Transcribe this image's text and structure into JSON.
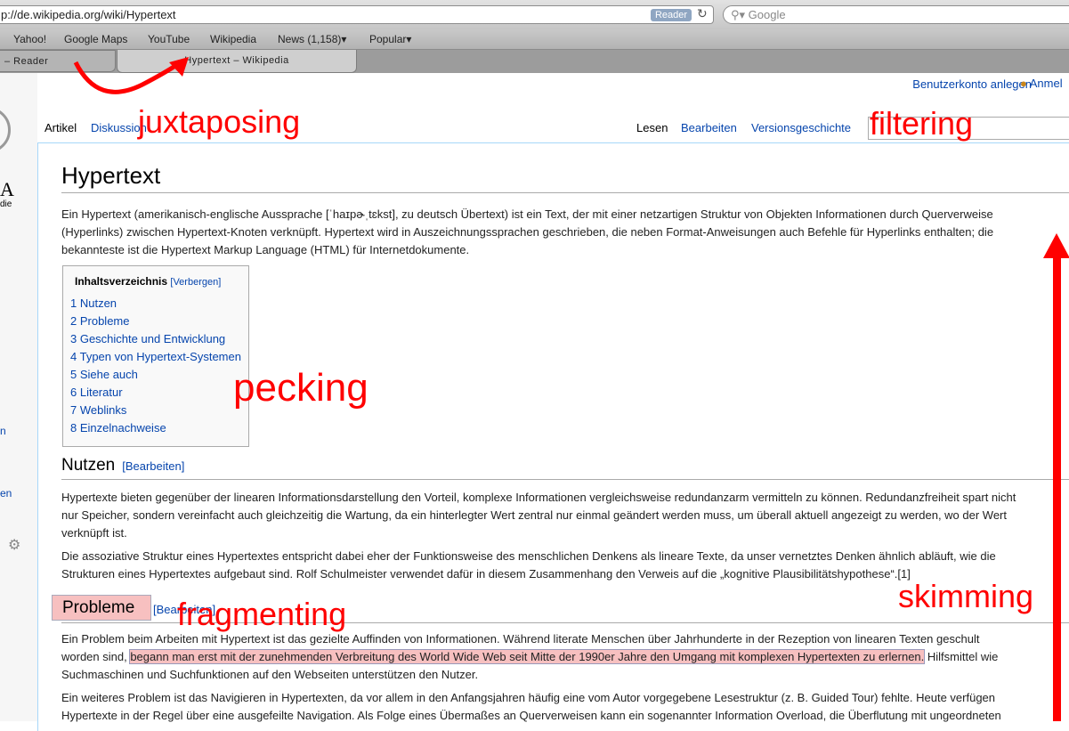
{
  "browser": {
    "url": "p://de.wikipedia.org/wiki/Hypertext",
    "reader_label": "Reader",
    "search_placeholder": "Google",
    "bookmarks": [
      "Yahoo!",
      "Google Maps",
      "YouTube",
      "Wikipedia",
      "News (1,158)",
      "Popular"
    ],
    "tabs": [
      "– Reader",
      "Hypertext – Wikipedia"
    ]
  },
  "wiki": {
    "personal": "Benutzerkonto anlegen",
    "login": "Anmel",
    "ns_tabs": [
      "Artikel",
      "Diskussion"
    ],
    "view_tabs": [
      "Lesen",
      "Bearbeiten",
      "Versionsgeschichte"
    ],
    "title": "Hypertext",
    "intro": [
      "Ein Hypertext (amerikanisch-englische Aussprache [ˈhaɪpɚˌtɛkst], zu deutsch Übertext) ist ein Text, der mit einer netzartigen Struktur von Objekten Informationen durch Querverweise",
      "(Hyperlinks) zwischen Hypertext-Knoten verknüpft. Hypertext wird in Auszeichnungssprachen geschrieben, die neben Format-Anweisungen auch Befehle für Hyperlinks enthalten; die",
      "bekannteste ist die Hypertext Markup Language (HTML) für Internetdokumente."
    ],
    "toc_title": "Inhaltsverzeichnis",
    "toc_toggle": "[Verbergen]",
    "toc": [
      "1  Nutzen",
      "2  Probleme",
      "3  Geschichte und Entwicklung",
      "4  Typen von Hypertext-Systemen",
      "5  Siehe auch",
      "6  Literatur",
      "7  Weblinks",
      "8  Einzelnachweise"
    ],
    "sec1_title": "Nutzen",
    "edit_label": "[Bearbeiten]",
    "sec1_p1": [
      "Hypertexte bieten gegenüber der linearen Informationsdarstellung den Vorteil, komplexe Informationen vergleichsweise redundanzarm vermitteln zu können. Redundanzfreiheit spart nicht",
      "nur Speicher, sondern vereinfacht auch gleichzeitig die Wartung, da ein hinterlegter Wert zentral nur einmal geändert werden muss, um überall aktuell angezeigt zu werden, wo der Wert",
      "verknüpft ist."
    ],
    "sec1_p2": [
      "Die assoziative Struktur eines Hypertextes entspricht dabei eher der Funktionsweise des menschlichen Denkens als lineare Texte, da unser vernetztes Denken ähnlich abläuft, wie die",
      "Strukturen eines Hypertextes aufgebaut sind. Rolf Schulmeister verwendet dafür in diesem Zusammenhang den Verweis auf die „kognitive Plausibilitätshypothese“.[1]"
    ],
    "sec2_title": "Probleme",
    "sec2_edit": "[Bearbeiten]",
    "sec2_p1_a": "Ein Problem beim Arbeiten mit Hypertext ist das gezielte Auffinden von Informationen. Während literate Menschen über Jahrhunderte in der Rezeption von linearen Texten geschult",
    "sec2_p1_b_pre": "worden sind, ",
    "sec2_p1_b_hl": "begann man erst mit der zunehmenden Verbreitung des World Wide Web seit Mitte der 1990er Jahre den Umgang mit komplexen Hypertexten zu erlernen.",
    "sec2_p1_b_post": " Hilfsmittel wie",
    "sec2_p1_c": "Suchmaschinen und Suchfunktionen auf den Webseiten unterstützen den Nutzer.",
    "sec2_p2_a": "Ein weiteres Problem ist das Navigieren in Hypertexten, da vor allem in den Anfangsjahren häufig eine vom Autor vorgegebene Lesestruktur (z. B. Guided Tour) fehlte. Heute verfügen",
    "sec2_p2_b": "Hypertexte in der Regel über eine ausgefeilte Navigation. Als Folge eines Übermaßes an Querverweisen kann ein sogenannter Information Overload, die Überflutung mit ungeordneten"
  },
  "annotations": {
    "juxtaposing": "juxtaposing",
    "filtering": "filtering",
    "pecking": "pecking",
    "fragmenting": "fragmenting",
    "skimming": "skimming"
  },
  "colors": {
    "annotation": "#ff0000",
    "link": "#0645ad",
    "highlight": "#f7c0c0"
  }
}
